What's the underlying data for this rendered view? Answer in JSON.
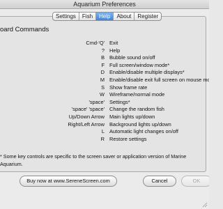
{
  "window": {
    "title": "Aquarium Preferences"
  },
  "tabs": [
    {
      "label": "Settings",
      "active": false
    },
    {
      "label": "Fish",
      "active": false
    },
    {
      "label": "Help",
      "active": true
    },
    {
      "label": "About",
      "active": false
    },
    {
      "label": "Register",
      "active": false
    }
  ],
  "help": {
    "heading": "oard Commands",
    "commands": [
      {
        "key": "Cmd-'Q'",
        "desc": "Exit"
      },
      {
        "key": "?",
        "desc": "Help"
      },
      {
        "key": "B",
        "desc": "Bubble sound on/off"
      },
      {
        "key": "F",
        "desc": "Full screen/window mode*"
      },
      {
        "key": "D",
        "desc": "Enable/disable multiple displays*"
      },
      {
        "key": "M",
        "desc": "Enable/disable exit full screen on mouse move"
      },
      {
        "key": "S",
        "desc": "Show frame rate"
      },
      {
        "key": "W",
        "desc": "Wireframe/normal mode"
      },
      {
        "key": "'space'",
        "desc": "Settings*"
      },
      {
        "key": "'space' 'space'",
        "desc": "Change the random fish"
      },
      {
        "key": "Up/Down Arrow",
        "desc": "Main lights up/down"
      },
      {
        "key": "Right/Left Arrow",
        "desc": "Background lights up/down"
      },
      {
        "key": "L",
        "desc": "Automatic light changes on/off"
      },
      {
        "key": "R",
        "desc": "Restore settings"
      }
    ],
    "footnote": "* Some key controls are specific to the screen saver or application version of Marine Aquarium."
  },
  "buttons": {
    "buy": "Buy now at www.SereneScreen.com",
    "cancel": "Cancel",
    "ok": "OK"
  },
  "colors": {
    "active_tab": "#4a8ee3",
    "window_bg": "#ebebeb",
    "disabled_text": "#a6a6a6"
  }
}
